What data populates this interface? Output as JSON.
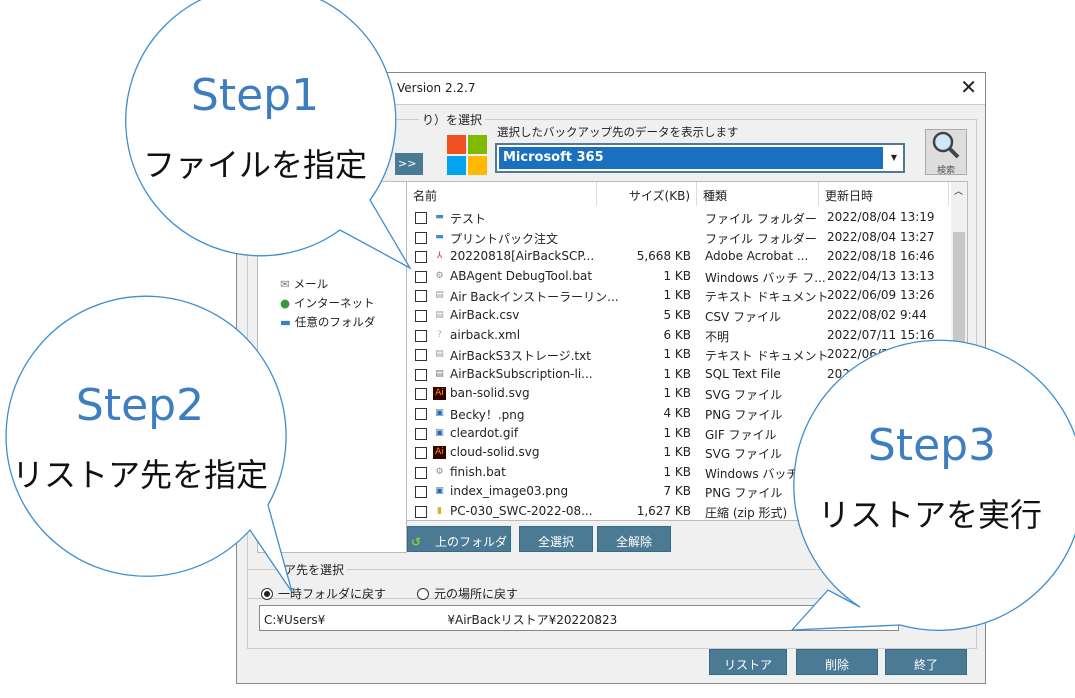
{
  "window": {
    "title": "Version 2.2.7",
    "close_icon": "close-icon"
  },
  "source": {
    "group_label": "り）を選択",
    "hint": "選択したバックアップ先のデータを表示します",
    "selected": "Microsoft 365",
    "search_label": "検索",
    "expand_label": ">>"
  },
  "tree": {
    "items": [
      "メール",
      "インターネット",
      "任意のフォルダ"
    ]
  },
  "list": {
    "headers": [
      "名前",
      "サイズ(KB)",
      "種類",
      "更新日時"
    ],
    "rows": [
      {
        "icon": "folder",
        "name": "テスト",
        "size": "",
        "type": "ファイル フォルダー",
        "date": "2022/08/04 13:19"
      },
      {
        "icon": "folder",
        "name": "プリントパック注文",
        "size": "",
        "type": "ファイル フォルダー",
        "date": "2022/08/04 13:27"
      },
      {
        "icon": "pdf",
        "name": "20220818[AirBackSCP...",
        "size": "5,668 KB",
        "type": "Adobe Acrobat ...",
        "date": "2022/08/18 16:46"
      },
      {
        "icon": "bat",
        "name": "ABAgent DebugTool.bat",
        "size": "1 KB",
        "type": "Windows バッチ フ...",
        "date": "2022/04/13 13:13"
      },
      {
        "icon": "text",
        "name": "Air Backインストーラーリン...",
        "size": "1 KB",
        "type": "テキスト ドキュメント",
        "date": "2022/06/09 13:26"
      },
      {
        "icon": "text",
        "name": "AirBack.csv",
        "size": "5 KB",
        "type": "CSV ファイル",
        "date": "2022/08/02 9:44"
      },
      {
        "icon": "unknown",
        "name": "airback.xml",
        "size": "6 KB",
        "type": "不明",
        "date": "2022/07/11 15:16"
      },
      {
        "icon": "text",
        "name": "AirBackS3ストレージ.txt",
        "size": "1 KB",
        "type": "テキスト ドキュメント",
        "date": "2022/06/30"
      },
      {
        "icon": "sql",
        "name": "AirBackSubscription-li...",
        "size": "1 KB",
        "type": "SQL Text File",
        "date": "2022"
      },
      {
        "icon": "ai",
        "name": "ban-solid.svg",
        "size": "1 KB",
        "type": "SVG ファイル",
        "date": ""
      },
      {
        "icon": "image",
        "name": "Becky！.png",
        "size": "4 KB",
        "type": "PNG ファイル",
        "date": ""
      },
      {
        "icon": "image",
        "name": "cleardot.gif",
        "size": "1 KB",
        "type": "GIF ファイル",
        "date": ""
      },
      {
        "icon": "ai",
        "name": "cloud-solid.svg",
        "size": "1 KB",
        "type": "SVG ファイル",
        "date": ""
      },
      {
        "icon": "bat",
        "name": "finish.bat",
        "size": "1 KB",
        "type": "Windows バッチ",
        "date": ""
      },
      {
        "icon": "image",
        "name": "index_image03.png",
        "size": "7 KB",
        "type": "PNG ファイル",
        "date": ""
      },
      {
        "icon": "zip",
        "name": "PC-030_SWC-2022-08...",
        "size": "1,627 KB",
        "type": "圧縮 (zip 形式)",
        "date": ""
      }
    ]
  },
  "list_buttons": {
    "up": "上のフォルダ",
    "select_all": "全選択",
    "deselect_all": "全解除"
  },
  "restore": {
    "group_label": "ア先を選択",
    "option_temp": "一時フォルダに戻す",
    "option_original": "元の場所に戻す",
    "selected_option": "一時フォルダに戻す",
    "path": "C:¥Users¥                                ¥AirBackリストア¥20220823"
  },
  "actions": {
    "restore": "リストア",
    "delete": "削除",
    "exit": "終了"
  },
  "callouts": [
    {
      "step": "Step1",
      "text": "ファイルを指定"
    },
    {
      "step": "Step2",
      "text": "リストア先を指定"
    },
    {
      "step": "Step3",
      "text": "リストアを実行"
    }
  ],
  "colors": {
    "accent": "#4a7a94",
    "callout_blue": "#3d7dc0",
    "combo_selected": "#1a6fbf"
  }
}
